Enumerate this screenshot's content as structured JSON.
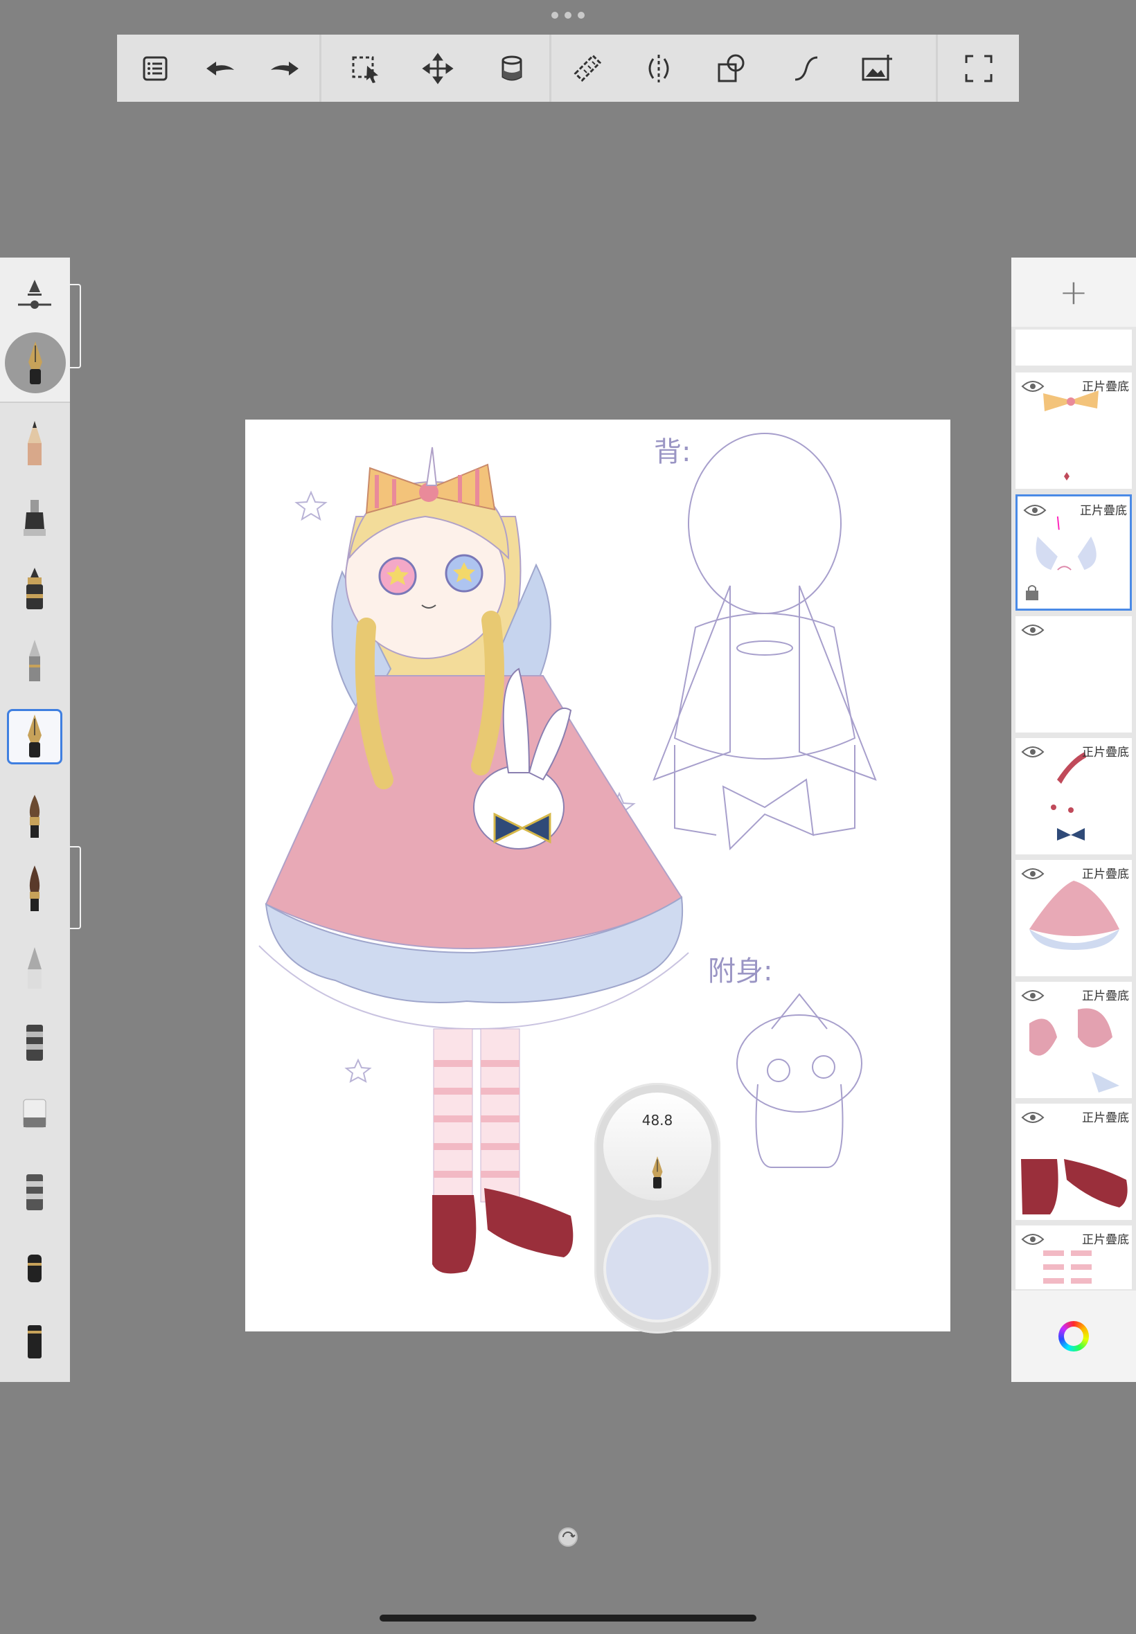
{
  "toolbar": {
    "tools": [
      {
        "name": "list-icon"
      },
      {
        "name": "undo-icon"
      },
      {
        "name": "redo-icon"
      },
      {
        "name": "selection-icon"
      },
      {
        "name": "transform-icon"
      },
      {
        "name": "fill-bucket-icon"
      },
      {
        "name": "ruler-icon"
      },
      {
        "name": "symmetry-icon"
      },
      {
        "name": "shapes-icon"
      },
      {
        "name": "curve-icon"
      },
      {
        "name": "add-image-icon"
      },
      {
        "name": "fullscreen-icon"
      }
    ]
  },
  "brushes": {
    "selected_index": 5,
    "items": [
      "pencil-brush",
      "marker-brush",
      "ink-brush",
      "airbrush-brush",
      "fountain-pen-brush",
      "paintbrush-brush",
      "round-brush",
      "chisel-brush",
      "smudge-brush",
      "eraser-brush",
      "blender-brush",
      "soft-brush",
      "chalk-brush"
    ]
  },
  "brush_puck": {
    "size_value": "48.8",
    "color": "#d8deef"
  },
  "layers": {
    "items": [
      {
        "blend": "",
        "visible": false
      },
      {
        "blend": "正片疊底",
        "visible": true
      },
      {
        "blend": "正片疊底",
        "visible": true,
        "selected": true,
        "locked": true
      },
      {
        "blend": "",
        "visible": true
      },
      {
        "blend": "正片疊底",
        "visible": true
      },
      {
        "blend": "正片疊底",
        "visible": true
      },
      {
        "blend": "正片疊底",
        "visible": true
      },
      {
        "blend": "正片疊底",
        "visible": true
      },
      {
        "blend": "正片疊底",
        "visible": true
      }
    ]
  },
  "canvas": {
    "label_back": "背:",
    "label_possess": "附身:"
  },
  "colors": {
    "background": "#828282",
    "accent": "#3f7fe0"
  }
}
